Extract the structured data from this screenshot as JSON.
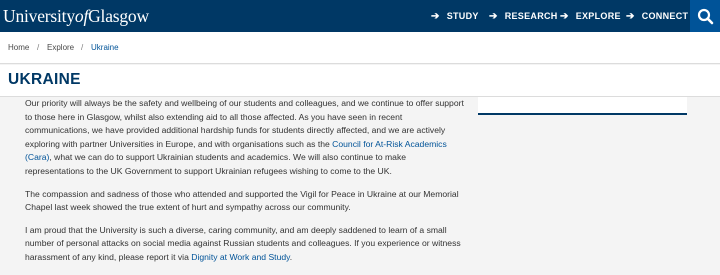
{
  "header": {
    "logo_text_1": "University",
    "logo_text_2": "of",
    "logo_text_3": "Glasgow",
    "nav": [
      {
        "label": "STUDY",
        "icon": "arrow-right-icon"
      },
      {
        "label": "RESEARCH",
        "icon": "arrow-right-icon"
      },
      {
        "label": "EXPLORE",
        "icon": "arrow-right-icon"
      },
      {
        "label": "CONNECT",
        "icon": "arrow-right-icon"
      }
    ],
    "search_icon": "search-icon"
  },
  "breadcrumb": {
    "items": [
      "Home",
      "Explore",
      "Ukraine"
    ],
    "separator": "/"
  },
  "page": {
    "title": "UKRAINE"
  },
  "content": {
    "p1_a": "Our priority will always be the safety and wellbeing of our students and colleagues, and we continue to offer support to those here in Glasgow, whilst also extending aid to all those affected. As you have seen in recent communications, we have provided additional hardship funds for students directly affected, and we are actively exploring with partner Universities in Europe, and with organisations such as the ",
    "p1_link": "Council for At-Risk Academics (Cara)",
    "p1_b": ", what we can do to support Ukrainian students and academics. We will also continue to make representations to the UK Government to support Ukrainian refugees wishing to come to the UK.",
    "p2": "The compassion and sadness of those who attended and supported the Vigil for Peace in Ukraine at our Memorial Chapel last week showed the true extent of hurt and sympathy across our community.",
    "p3_a": "I am proud that the University is such a diverse, caring community, and am deeply saddened to learn of a small number of personal attacks on social media against Russian students and colleagues. If you experience or witness harassment of any kind, please report it via ",
    "p3_link": "Dignity at Work and Study",
    "p3_b": "."
  },
  "colors": {
    "header_bg": "#003865",
    "search_bg": "#005398",
    "link": "#005398",
    "title": "#003865",
    "body_bg": "#f4f4f4"
  }
}
